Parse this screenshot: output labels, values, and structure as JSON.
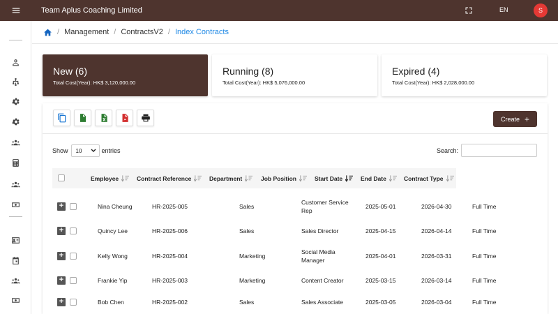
{
  "app": {
    "title": "Team Aplus Coaching Limited",
    "lang": "EN",
    "avatar_initial": "S"
  },
  "colors": {
    "primary": "#4e342e",
    "link": "#1e88e5",
    "avatar": "#e53935"
  },
  "breadcrumb": {
    "items": [
      "Management",
      "ContractsV2"
    ],
    "active": "Index Contracts"
  },
  "cards": [
    {
      "title": "New (6)",
      "subtitle": "Total Cost(Year): HK$ 3,120,000.00"
    },
    {
      "title": "Running (8)",
      "subtitle": "Total Cost(Year): HK$ 5,076,000.00"
    },
    {
      "title": "Expired (4)",
      "subtitle": "Total Cost(Year): HK$ 2,028,000.00"
    }
  ],
  "toolbar": {
    "create_label": "Create",
    "create_icon": "plus-icon"
  },
  "table_controls": {
    "show_label": "Show",
    "entries_value": "10",
    "entries_label": "entries",
    "search_label": "Search:"
  },
  "table": {
    "columns": [
      "Employee",
      "Contract Reference",
      "Department",
      "Job Position",
      "Start Date",
      "End Date",
      "Contract Type"
    ],
    "rows": [
      {
        "employee": "Nina Cheung",
        "ref": "HR-2025-005",
        "dept": "Sales",
        "position": "Customer Service Rep",
        "start": "2025-05-01",
        "end": "2026-04-30",
        "type": "Full Time"
      },
      {
        "employee": "Quincy Lee",
        "ref": "HR-2025-006",
        "dept": "Sales",
        "position": "Sales Director",
        "start": "2025-04-15",
        "end": "2026-04-14",
        "type": "Full Time"
      },
      {
        "employee": "Kelly Wong",
        "ref": "HR-2025-004",
        "dept": "Marketing",
        "position": "Social Media Manager",
        "start": "2025-04-01",
        "end": "2026-03-31",
        "type": "Full Time"
      },
      {
        "employee": "Frankie Yip",
        "ref": "HR-2025-003",
        "dept": "Marketing",
        "position": "Content Creator",
        "start": "2025-03-15",
        "end": "2026-03-14",
        "type": "Full Time"
      },
      {
        "employee": "Bob Chen",
        "ref": "HR-2025-002",
        "dept": "Sales",
        "position": "Sales Associate",
        "start": "2025-03-05",
        "end": "2026-03-04",
        "type": "Full Time"
      }
    ]
  }
}
